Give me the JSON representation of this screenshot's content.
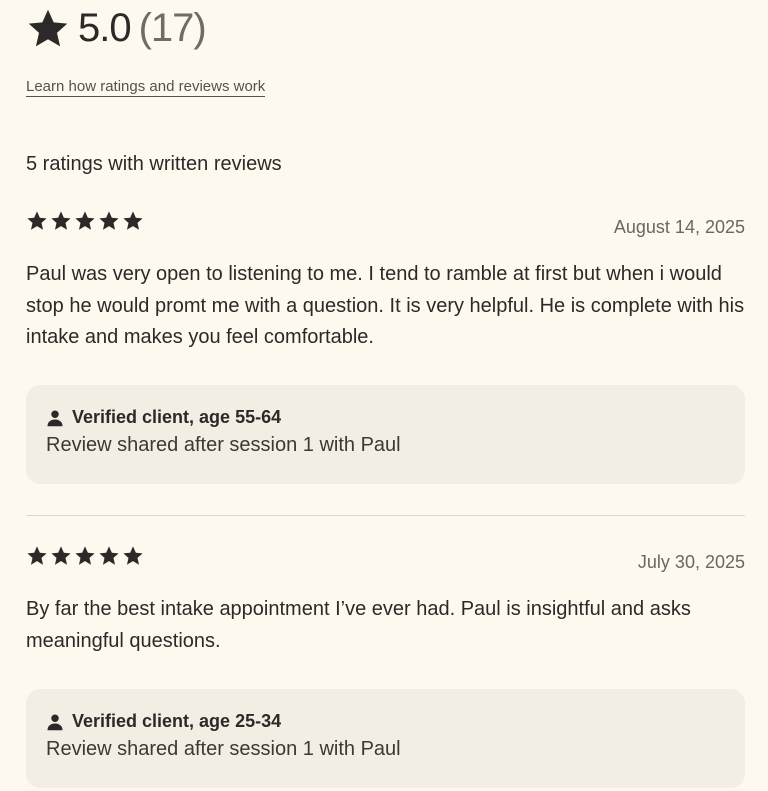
{
  "summary": {
    "score": "5.0",
    "count": "(17)",
    "icon": "star-icon"
  },
  "learn_link": "Learn how ratings and reviews work",
  "section_title": "5 ratings with written reviews",
  "reviews": [
    {
      "stars": 5,
      "date": "August 14, 2025",
      "text": "Paul was very open to listening to me. I tend to ramble at first but when i would stop he would promt me with a question. It is very helpful. He is complete with his intake and makes you feel comfortable.",
      "client": "Verified client, age 55-64",
      "session": "Review shared after session 1 with Paul"
    },
    {
      "stars": 5,
      "date": "July 30, 2025",
      "text": "By far the best intake appointment I’ve ever had. Paul is insightful and asks meaningful questions.",
      "client": "Verified client, age 25-34",
      "session": "Review shared after session 1 with Paul"
    }
  ],
  "colors": {
    "background": "#fdf9ee",
    "card": "#f2eee4",
    "text": "#2b2a28",
    "muted": "#6a6762"
  }
}
